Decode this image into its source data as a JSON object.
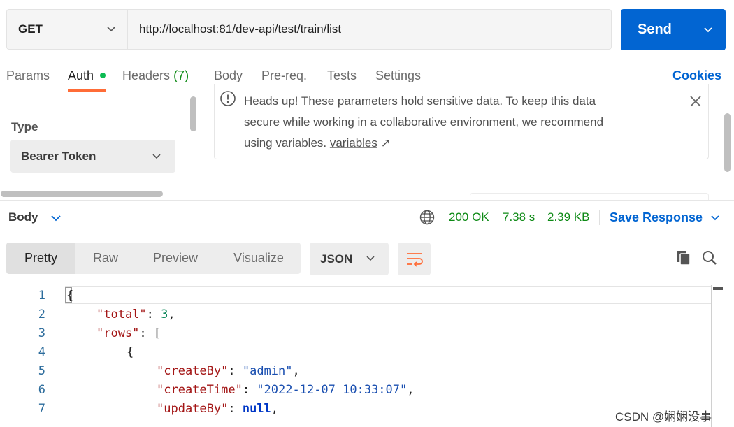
{
  "request": {
    "method": "GET",
    "url": "http://localhost:81/dev-api/test/train/list",
    "send_label": "Send"
  },
  "tabs": [
    {
      "label": "Params"
    },
    {
      "label": "Auth"
    },
    {
      "label": "Headers",
      "count": "(7)"
    },
    {
      "label": "Body"
    },
    {
      "label": "Pre-req."
    },
    {
      "label": "Tests"
    },
    {
      "label": "Settings"
    }
  ],
  "cookies_label": "Cookies",
  "auth": {
    "type_label": "Type",
    "type_value": "Bearer Token",
    "alert_line1": "Heads up! These parameters hold sensitive data. To keep this data",
    "alert_line2": "secure while working in a collaborative environment, we recommend",
    "alert_line3_prefix": "using variables. ",
    "alert_link": "variables",
    "alert_link_arrow": "↗"
  },
  "response": {
    "section_label": "Body",
    "status": "200 OK",
    "time": "7.38 s",
    "size": "2.39 KB",
    "save_label": "Save Response"
  },
  "view": {
    "modes": [
      "Pretty",
      "Raw",
      "Preview",
      "Visualize"
    ],
    "active_mode": "Pretty",
    "format": "JSON"
  },
  "code": {
    "line_numbers": [
      "1",
      "2",
      "3",
      "4",
      "5",
      "6",
      "7"
    ],
    "open_brace": "{",
    "total_key": "\"total\"",
    "total_value": "3",
    "rows_key": "\"rows\"",
    "rows_open": "[",
    "row_open": "{",
    "createBy_key": "\"createBy\"",
    "createBy_value": "\"admin\"",
    "createTime_key": "\"createTime\"",
    "createTime_value": "\"2022-12-07 10:33:07\"",
    "updateBy_key": "\"updateBy\"",
    "updateBy_value": "null"
  },
  "watermark": "CSDN @娴娴没事"
}
